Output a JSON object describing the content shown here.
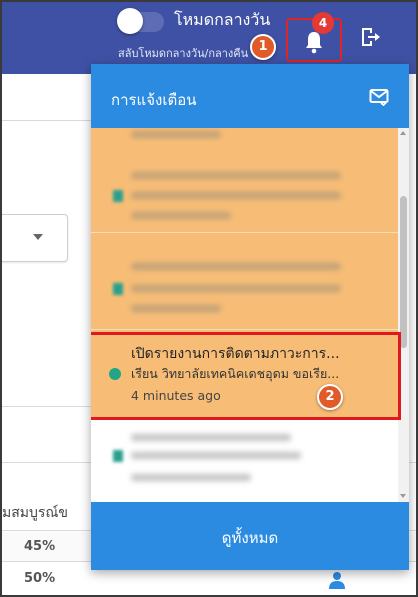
{
  "topbar": {
    "mode_title": "โหมดกลางวัน",
    "mode_subtitle": "สลับโหมดกลางวัน/กลางคืน",
    "notification_count": "4",
    "colors": {
      "bar": "#3f51a4",
      "badge": "#e53935"
    }
  },
  "step_markers": {
    "first": "1",
    "second": "2"
  },
  "background_page": {
    "column_header_fragment": "มสมบูรณ์ข",
    "rows": [
      {
        "percent": "45%"
      },
      {
        "percent": "50%"
      }
    ]
  },
  "notifications": {
    "title": "การแจ้งเตือน",
    "highlighted": {
      "title": "เปิดรายงานการติดตามภาวะการ...",
      "subtitle": "เรียน วิทยาลัยเทคนิคเดชอุดม ขอเรีย...",
      "time": "4 minutes ago"
    },
    "view_all_label": "ดูทั้งหมด",
    "colors": {
      "header": "#2b8be1",
      "unread_bg": "#f7bd77",
      "dot": "#21a586"
    }
  }
}
